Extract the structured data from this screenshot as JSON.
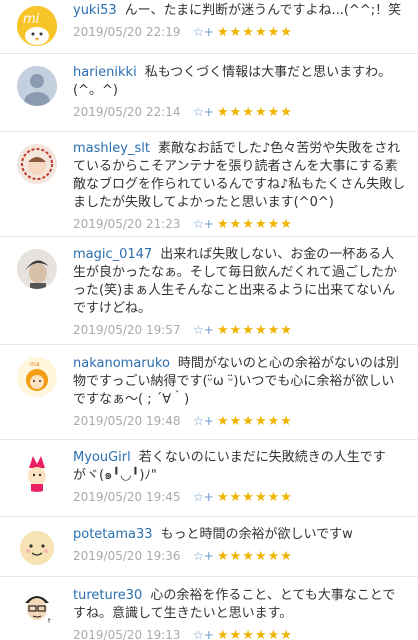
{
  "comments": [
    {
      "user": "yuki53",
      "text": "んー、たまに判断が迷うんですよね...(^^;！笑",
      "time": "2019/05/20 22:19",
      "stars": "★★★★★★",
      "add": "☆+"
    },
    {
      "user": "harienikki",
      "text": "私もつくづく情報は大事だと思いますわ。(^。^)",
      "time": "2019/05/20 22:14",
      "stars": "★★★★★★",
      "add": "☆+"
    },
    {
      "user": "mashley_slt",
      "text": "素敵なお話でした♪色々苦労や失敗をされているからこそアンテナを張り読者さんを大事にする素敵なブログを作られているんですね♪私もたくさん失敗しましたが失敗してよかったと思います(^0^)",
      "time": "2019/05/20 21:23",
      "stars": "★★★★★★",
      "add": "☆+"
    },
    {
      "user": "magic_0147",
      "text": "出来れば失敗しない、お金の一杯ある人生が良かったなぁ。そして毎日飲んだくれて過ごしたかった(笑)まぁ人生そんなこと出来るように出来てないんですけどね。",
      "time": "2019/05/20 19:57",
      "stars": "★★★★★★",
      "add": "☆+"
    },
    {
      "user": "nakanomaruko",
      "text": "時間がないのと心の余裕がないのは別物ですっごい納得です(ᵕ̈ω ᵕ̈)いつでも心に余裕が欲しいですなぁ〜( ; ´∀｀)",
      "time": "2019/05/20 19:48",
      "stars": "★★★★★★",
      "add": "☆+"
    },
    {
      "user": "MyouGirl",
      "text": "若くないのにいまだに失敗続きの人生ですがヾ(๑╹◡╹)ﾉ\"",
      "time": "2019/05/20 19:45",
      "stars": "★★★★★★",
      "add": "☆+"
    },
    {
      "user": "potetama33",
      "text": "もっと時間の余裕が欲しいですw",
      "time": "2019/05/20 19:36",
      "stars": "★★★★★★",
      "add": "☆+"
    },
    {
      "user": "tureture30",
      "text": "心の余裕を作ること、とても大事なことですね。意識して生きたいと思います。",
      "time": "2019/05/20 19:13",
      "stars": "★★★★★★",
      "add": "☆+"
    }
  ]
}
